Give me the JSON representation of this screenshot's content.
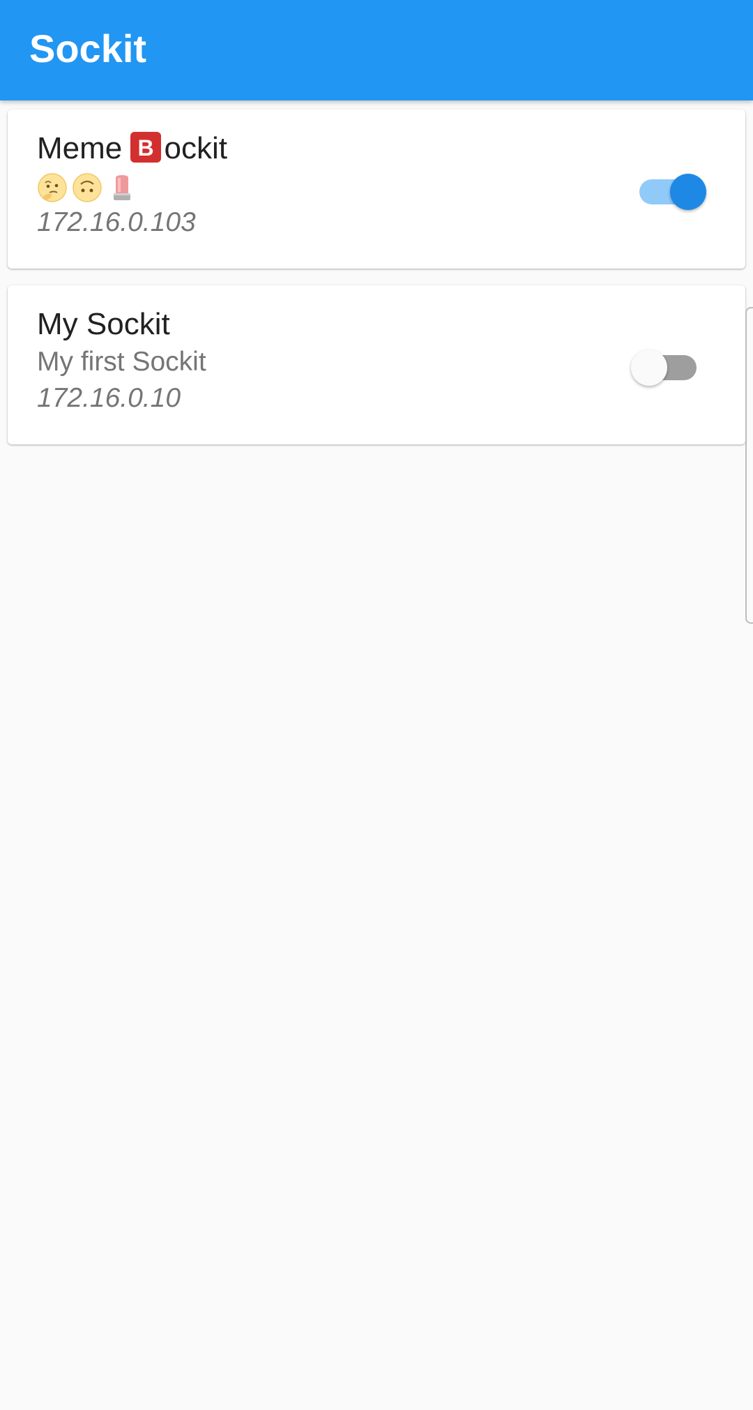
{
  "app": {
    "title": "Sockit",
    "colors": {
      "primary": "#2196f3",
      "switch_on": "#1e88e5",
      "switch_on_track": "#90caf9",
      "switch_off_track": "#9e9e9e"
    }
  },
  "sockits": [
    {
      "title_prefix": "Meme ",
      "title_glyph": "B",
      "title_suffix": "ockit",
      "subtitle_emojis": [
        "thinking-face-icon",
        "upside-down-face-icon",
        "police-light-icon"
      ],
      "ip": "172.16.0.103",
      "enabled": true
    },
    {
      "title": "My Sockit",
      "subtitle": "My first Sockit",
      "ip": "172.16.0.10",
      "enabled": false
    }
  ]
}
